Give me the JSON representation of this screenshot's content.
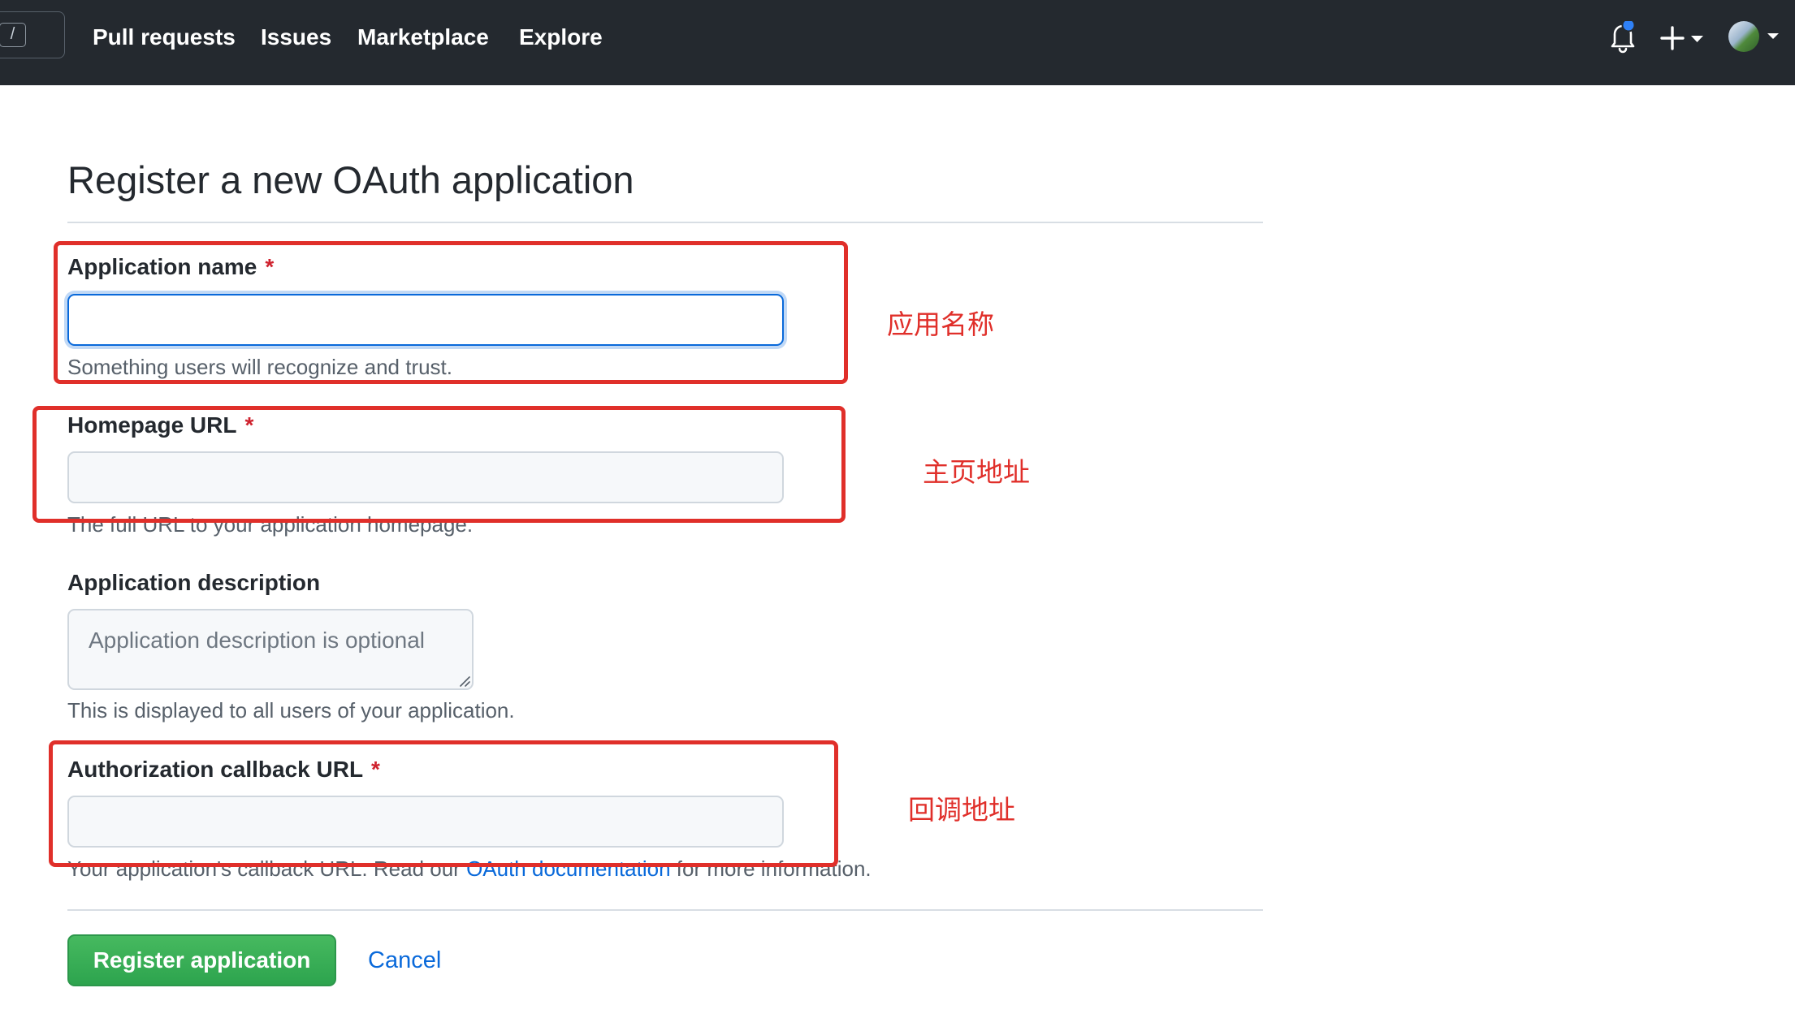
{
  "topbar": {
    "search_key": "/",
    "nav": [
      "Pull requests",
      "Issues",
      "Marketplace",
      "Explore"
    ],
    "icons": [
      "bell-icon",
      "plus-icon",
      "caret-down-icon",
      "avatar"
    ],
    "colors": {
      "background": "#24292f",
      "notification_dot": "#2f81f7"
    }
  },
  "page": {
    "title": "Register a new OAuth application"
  },
  "form": {
    "app_name": {
      "label": "Application name",
      "required_mark": "*",
      "value": "",
      "hint": "Something users will recognize and trust."
    },
    "homepage": {
      "label": "Homepage URL",
      "required_mark": "*",
      "value": "",
      "hint": "The full URL to your application homepage."
    },
    "description": {
      "label": "Application description",
      "placeholder": "Application description is optional",
      "hint": "This is displayed to all users of your application."
    },
    "callback": {
      "label": "Authorization callback URL",
      "required_mark": "*",
      "value": "",
      "hint_prefix": "Your application's callback URL. Read our ",
      "hint_link": "OAuth documentation",
      "hint_suffix": " for more information."
    }
  },
  "actions": {
    "register_label": "Register application",
    "cancel_label": "Cancel",
    "register_color": "#2da44e"
  },
  "annotations": {
    "app_name": "应用名称",
    "homepage": "主页地址",
    "callback": "回调地址",
    "color": "#e02f2a"
  }
}
